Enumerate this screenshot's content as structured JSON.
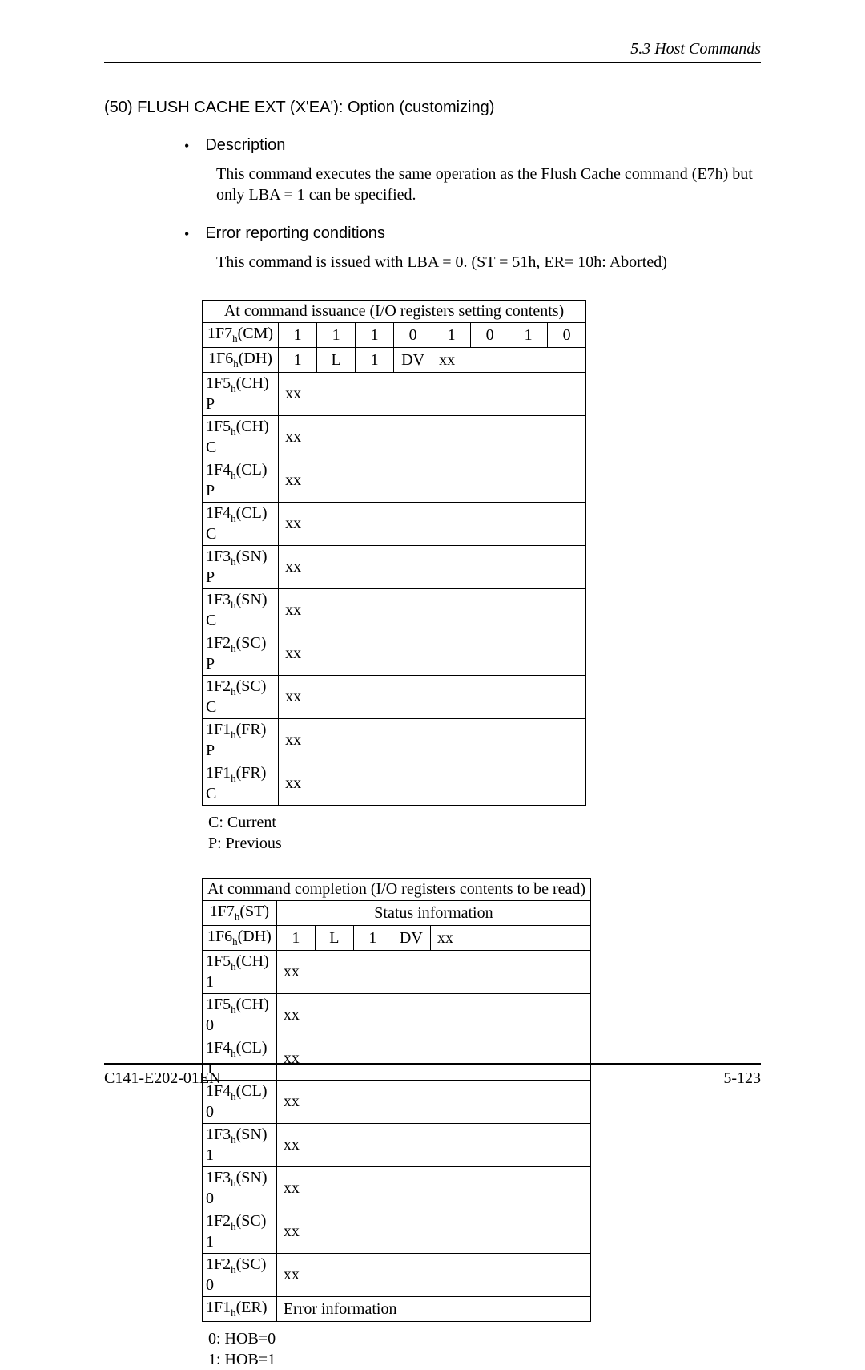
{
  "header": {
    "section": "5.3  Host Commands"
  },
  "title": "(50)  FLUSH CACHE EXT (X'EA'):  Option (customizing)",
  "bullets": {
    "desc_label": "Description",
    "desc_text": "This command executes the same operation as the Flush Cache command (E7h) but only LBA = 1 can be specified.",
    "err_label": "Error reporting conditions",
    "err_text": "This command is issued with LBA = 0.  (ST = 51h, ER= 10h:  Aborted)"
  },
  "table1": {
    "title": "At command issuance (I/O registers setting contents)",
    "rows": [
      {
        "label_main": "1F7",
        "label_sub": "h",
        "label_rest": "(CM)",
        "bits": [
          "1",
          "1",
          "1",
          "0",
          "1",
          "0",
          "1",
          "0"
        ]
      },
      {
        "label_main": "1F6",
        "label_sub": "h",
        "label_rest": "(DH)",
        "bits": [
          "1",
          "L",
          "1",
          "DV",
          "xx",
          "",
          "",
          ""
        ],
        "merge_from": 4
      },
      {
        "label_main": "1F5",
        "label_sub": "h",
        "label_rest": "(CH) P",
        "full": "xx"
      },
      {
        "label_main": "1F5",
        "label_sub": "h",
        "label_rest": "(CH) C",
        "full": "xx"
      },
      {
        "label_main": "1F4",
        "label_sub": "h",
        "label_rest": "(CL) P",
        "full": "xx"
      },
      {
        "label_main": "1F4",
        "label_sub": "h",
        "label_rest": "(CL) C",
        "full": "xx"
      },
      {
        "label_main": "1F3",
        "label_sub": "h",
        "label_rest": "(SN) P",
        "full": "xx"
      },
      {
        "label_main": "1F3",
        "label_sub": "h",
        "label_rest": "(SN) C",
        "full": "xx"
      },
      {
        "label_main": "1F2",
        "label_sub": "h",
        "label_rest": "(SC) P",
        "full": "xx"
      },
      {
        "label_main": "1F2",
        "label_sub": "h",
        "label_rest": "(SC) C",
        "full": "xx"
      },
      {
        "label_main": "1F1",
        "label_sub": "h",
        "label_rest": "(FR) P",
        "full": "xx"
      },
      {
        "label_main": "1F1",
        "label_sub": "h",
        "label_rest": "(FR) C",
        "full": "xx"
      }
    ],
    "notes": [
      "C:  Current",
      "P:  Previous"
    ]
  },
  "table2": {
    "title": "At command completion (I/O registers contents to be read)",
    "rows": [
      {
        "label_main": "1F7",
        "label_sub": "h",
        "label_rest": "(ST)",
        "full_center": "Status information"
      },
      {
        "label_main": "1F6",
        "label_sub": "h",
        "label_rest": "(DH)",
        "bits": [
          "1",
          "L",
          "1",
          "DV",
          "xx",
          "",
          "",
          ""
        ],
        "merge_from": 4
      },
      {
        "label_main": "1F5",
        "label_sub": "h",
        "label_rest": "(CH) 1",
        "full": "xx"
      },
      {
        "label_main": "1F5",
        "label_sub": "h",
        "label_rest": "(CH) 0",
        "full": "xx"
      },
      {
        "label_main": "1F4",
        "label_sub": "h",
        "label_rest": "(CL) 1",
        "full": "xx"
      },
      {
        "label_main": "1F4",
        "label_sub": "h",
        "label_rest": "(CL) 0",
        "full": "xx"
      },
      {
        "label_main": "1F3",
        "label_sub": "h",
        "label_rest": "(SN) 1",
        "full": "xx"
      },
      {
        "label_main": "1F3",
        "label_sub": "h",
        "label_rest": "(SN) 0",
        "full": "xx"
      },
      {
        "label_main": "1F2",
        "label_sub": "h",
        "label_rest": "(SC) 1",
        "full": "xx"
      },
      {
        "label_main": "1F2",
        "label_sub": "h",
        "label_rest": "(SC) 0",
        "full": "xx"
      },
      {
        "label_main": "1F1",
        "label_sub": "h",
        "label_rest": "(ER)",
        "full": "Error information"
      }
    ],
    "notes": [
      "0:  HOB=0",
      "1:  HOB=1"
    ]
  },
  "footer": {
    "left": "C141-E202-01EN",
    "right": "5-123"
  }
}
